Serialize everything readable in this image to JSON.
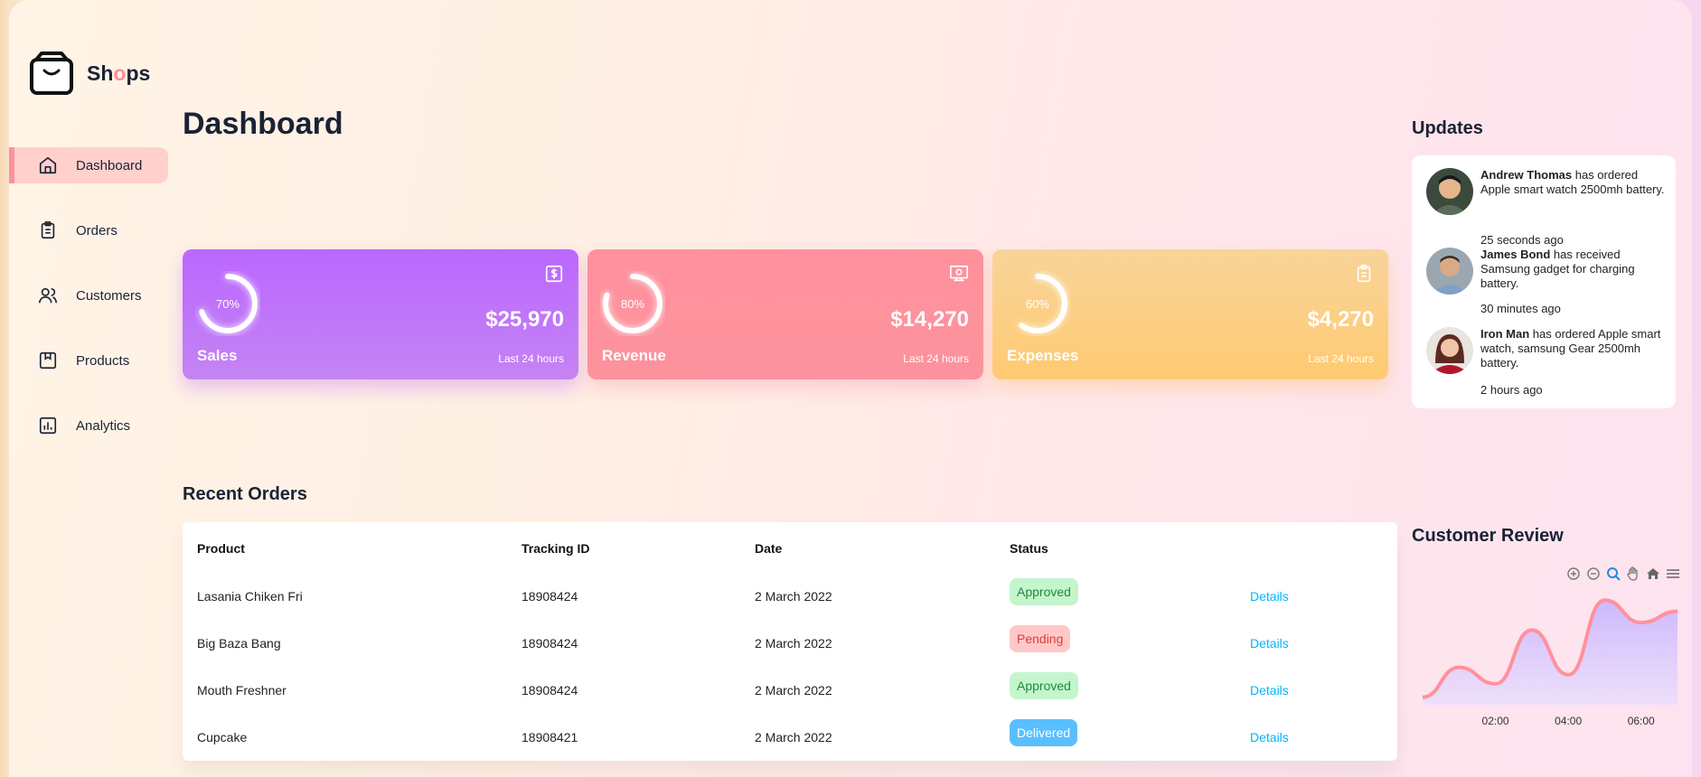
{
  "app": {
    "logo_text_before": "Sh",
    "logo_text_o": "o",
    "logo_text_after": "ps"
  },
  "sidebar": {
    "items": [
      {
        "label": "Dashboard",
        "icon": "home-icon",
        "active": true
      },
      {
        "label": "Orders",
        "icon": "clipboard-icon"
      },
      {
        "label": "Customers",
        "icon": "users-icon"
      },
      {
        "label": "Products",
        "icon": "package-icon"
      },
      {
        "label": "Analytics",
        "icon": "bar-chart-icon"
      }
    ]
  },
  "page": {
    "title": "Dashboard"
  },
  "cards": [
    {
      "label": "Sales",
      "percent": 70,
      "percent_label": "70%",
      "amount": "$25,970",
      "sub": "Last 24 hours",
      "icon": "dollar-icon",
      "color": "#bb67ff"
    },
    {
      "label": "Revenue",
      "percent": 80,
      "percent_label": "80%",
      "amount": "$14,270",
      "sub": "Last 24 hours",
      "icon": "money-icon",
      "color": "#ff919d"
    },
    {
      "label": "Expenses",
      "percent": 60,
      "percent_label": "60%",
      "amount": "$4,270",
      "sub": "Last 24 hours",
      "icon": "clipboard-icon",
      "color": "#ffca71"
    }
  ],
  "recent_orders": {
    "title": "Recent Orders",
    "columns": [
      "Product",
      "Tracking ID",
      "Date",
      "Status"
    ],
    "rows": [
      {
        "product": "Lasania Chiken Fri",
        "tracking": "18908424",
        "date": "2 March 2022",
        "status": "Approved",
        "action": "Details"
      },
      {
        "product": "Big Baza Bang",
        "tracking": "18908424",
        "date": "2 March 2022",
        "status": "Pending",
        "action": "Details"
      },
      {
        "product": "Mouth Freshner",
        "tracking": "18908424",
        "date": "2 March 2022",
        "status": "Approved",
        "action": "Details"
      },
      {
        "product": "Cupcake",
        "tracking": "18908421",
        "date": "2 March 2022",
        "status": "Delivered",
        "action": "Details"
      }
    ]
  },
  "updates": {
    "title": "Updates",
    "items": [
      {
        "name": "Andrew Thomas",
        "text": " has ordered Apple smart watch 2500mh battery.",
        "time": "25 seconds ago"
      },
      {
        "name": "James Bond",
        "text": " has received Samsung gadget for charging battery.",
        "time": "30 minutes ago"
      },
      {
        "name": "Iron Man",
        "text": " has ordered Apple smart watch, samsung Gear 2500mh battery.",
        "time": "2 hours ago"
      }
    ]
  },
  "customer_review": {
    "title": "Customer Review",
    "toolbar": [
      "zoom-in-icon",
      "zoom-out-icon",
      "zoom-select-icon",
      "pan-hand-icon",
      "reset-home-icon",
      "menu-icon"
    ]
  },
  "chart_data": {
    "type": "area",
    "x": [
      "00:00",
      "01:00",
      "02:00",
      "03:00",
      "04:00",
      "05:00",
      "06:00",
      "06:30"
    ],
    "tick_labels": [
      "02:00",
      "04:00",
      "06:00"
    ],
    "series": [
      {
        "values": [
          10,
          50,
          28,
          100,
          40,
          140,
          110,
          125
        ]
      }
    ],
    "line_color": "#ff919d",
    "fill_color": "#d8c7ff"
  }
}
